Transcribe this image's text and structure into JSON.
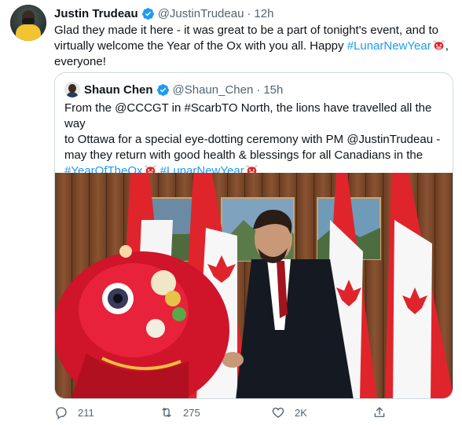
{
  "tweet": {
    "author_name": "Justin Trudeau",
    "author_handle": "@JustinTrudeau",
    "separator": "·",
    "time": "12h",
    "text_before": "Glad they made it here - it was great to be a part of tonight's event, and to virtually welcome the Year of the Ox with you all. Happy ",
    "hashtag": "#LunarNewYear",
    "text_after": ",",
    "text_end": "everyone!"
  },
  "quote": {
    "author_name": "Shaun Chen",
    "author_handle": "@Shaun_Chen",
    "separator": "·",
    "time": "15h",
    "line1": "From the @CCCGT in #ScarbTO North, the lions have travelled all the way",
    "line2": "to Ottawa for a special eye-dotting ceremony with PM @JustinTrudeau -",
    "line3": "may they return with good health & blessings for all Canadians in the",
    "hashtag1": "#YearOfTheOx",
    "hashtag2": "#LunarNewYear"
  },
  "actions": {
    "replies": "211",
    "retweets": "275",
    "likes": "2K"
  },
  "colors": {
    "link": "#1d9bf0",
    "secondary_text": "#536471",
    "flag_red": "#e0242b",
    "lion_red": "#d0142a"
  },
  "icons": [
    "verified-badge-icon",
    "more-options-icon",
    "ox-emoji-icon",
    "reply-icon",
    "retweet-icon",
    "like-icon",
    "share-icon"
  ]
}
